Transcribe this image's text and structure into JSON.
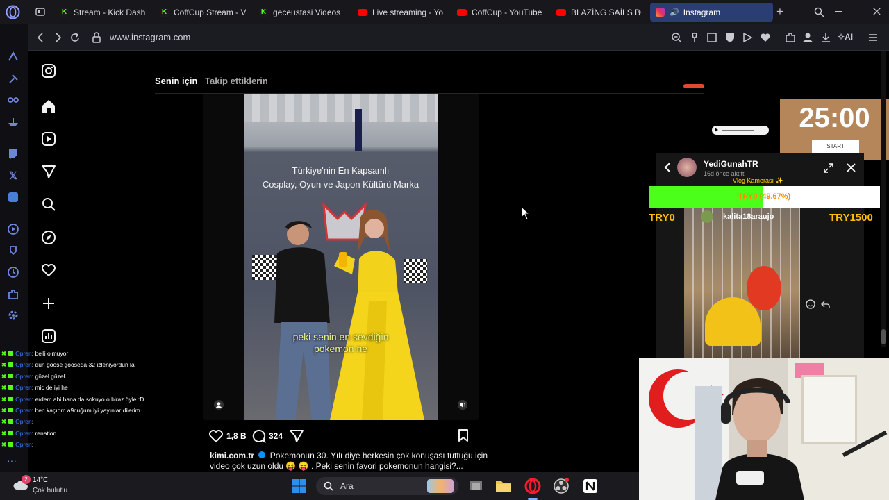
{
  "tabs": [
    {
      "label": "Stream - Kick Dash",
      "icon": "kick-icon",
      "x_note": "tab"
    },
    {
      "label": "CoffCup Stream - V",
      "icon": "kick-icon"
    },
    {
      "label": "geceustasi Videos",
      "icon": "kick-icon"
    },
    {
      "label": "Live streaming - Yo",
      "icon": "youtube-icon"
    },
    {
      "label": "CoffCup - YouTube",
      "icon": "youtube-icon"
    },
    {
      "label": "BLAZİNG SAİLS BÖ",
      "icon": "youtube-icon"
    },
    {
      "label": "Instagram",
      "icon": "instagram-icon",
      "active": true
    }
  ],
  "address": {
    "url": "www.instagram.com",
    "ai_label": "AI"
  },
  "feed": {
    "tab_for_you": "Senin için",
    "tab_following": "Takip ettiklerin",
    "post": {
      "sign_line1": "Türkiye'nin En Kapsamlı",
      "sign_line2": "Cosplay, Oyun ve Japon Kültürü Marka",
      "subtitle_line1": "peki senin en sevdiğin",
      "subtitle_line2": "pokemon ne",
      "likes": "1,8 B",
      "comments": "324",
      "author": "kimi.com.tr",
      "caption": "Pokemonun 30. Yılı diye herkesin çok konuşası tuttuğu için video çok uzun oldu 😝 😝 . Peki senin favori pokemonun hangisi?..."
    }
  },
  "pomodoro": {
    "time": "25:00",
    "start": "START"
  },
  "tiktok_card": {
    "user": "YediGunahTR",
    "status": "16d önce aktifti",
    "overlay_label": "Vlog Kamerası ✨",
    "viewer": "kalita18araujo"
  },
  "donation_goal": {
    "progress_text": "TRY0 (49.67%)",
    "fraction": 0.4967,
    "min": "TRY0",
    "max": "TRY1500"
  },
  "chat": [
    {
      "user": "Opren",
      "msg": ": belli olmuyor"
    },
    {
      "user": "Opren",
      "msg": ": dün goose gooseda 32 izleniyordun la"
    },
    {
      "user": "Opren",
      "msg": ": güzel güzel"
    },
    {
      "user": "Opren",
      "msg": ": mic de iyi he"
    },
    {
      "user": "Opren",
      "msg": ": erdem abi bana da sokuyo o biraz öyle :D"
    },
    {
      "user": "Opren",
      "msg": ": ben kaçıom a9cuğum iyi yayınlar dilerim"
    },
    {
      "user": "Opren",
      "msg": ":"
    },
    {
      "user": "Opren",
      "msg": ": renation"
    },
    {
      "user": "Opren",
      "msg": ":"
    }
  ],
  "taskbar": {
    "temp": "14°C",
    "weather": "Çok bulutlu",
    "weather_badge": "2",
    "search_label": "Ara"
  },
  "colors": {
    "tab_active": "#2b3e74",
    "opera_red": "#ff1b2d",
    "progress_green": "#4cff1a",
    "pomodoro_bg": "#b4865a",
    "chat_user": "#3f7dff"
  }
}
